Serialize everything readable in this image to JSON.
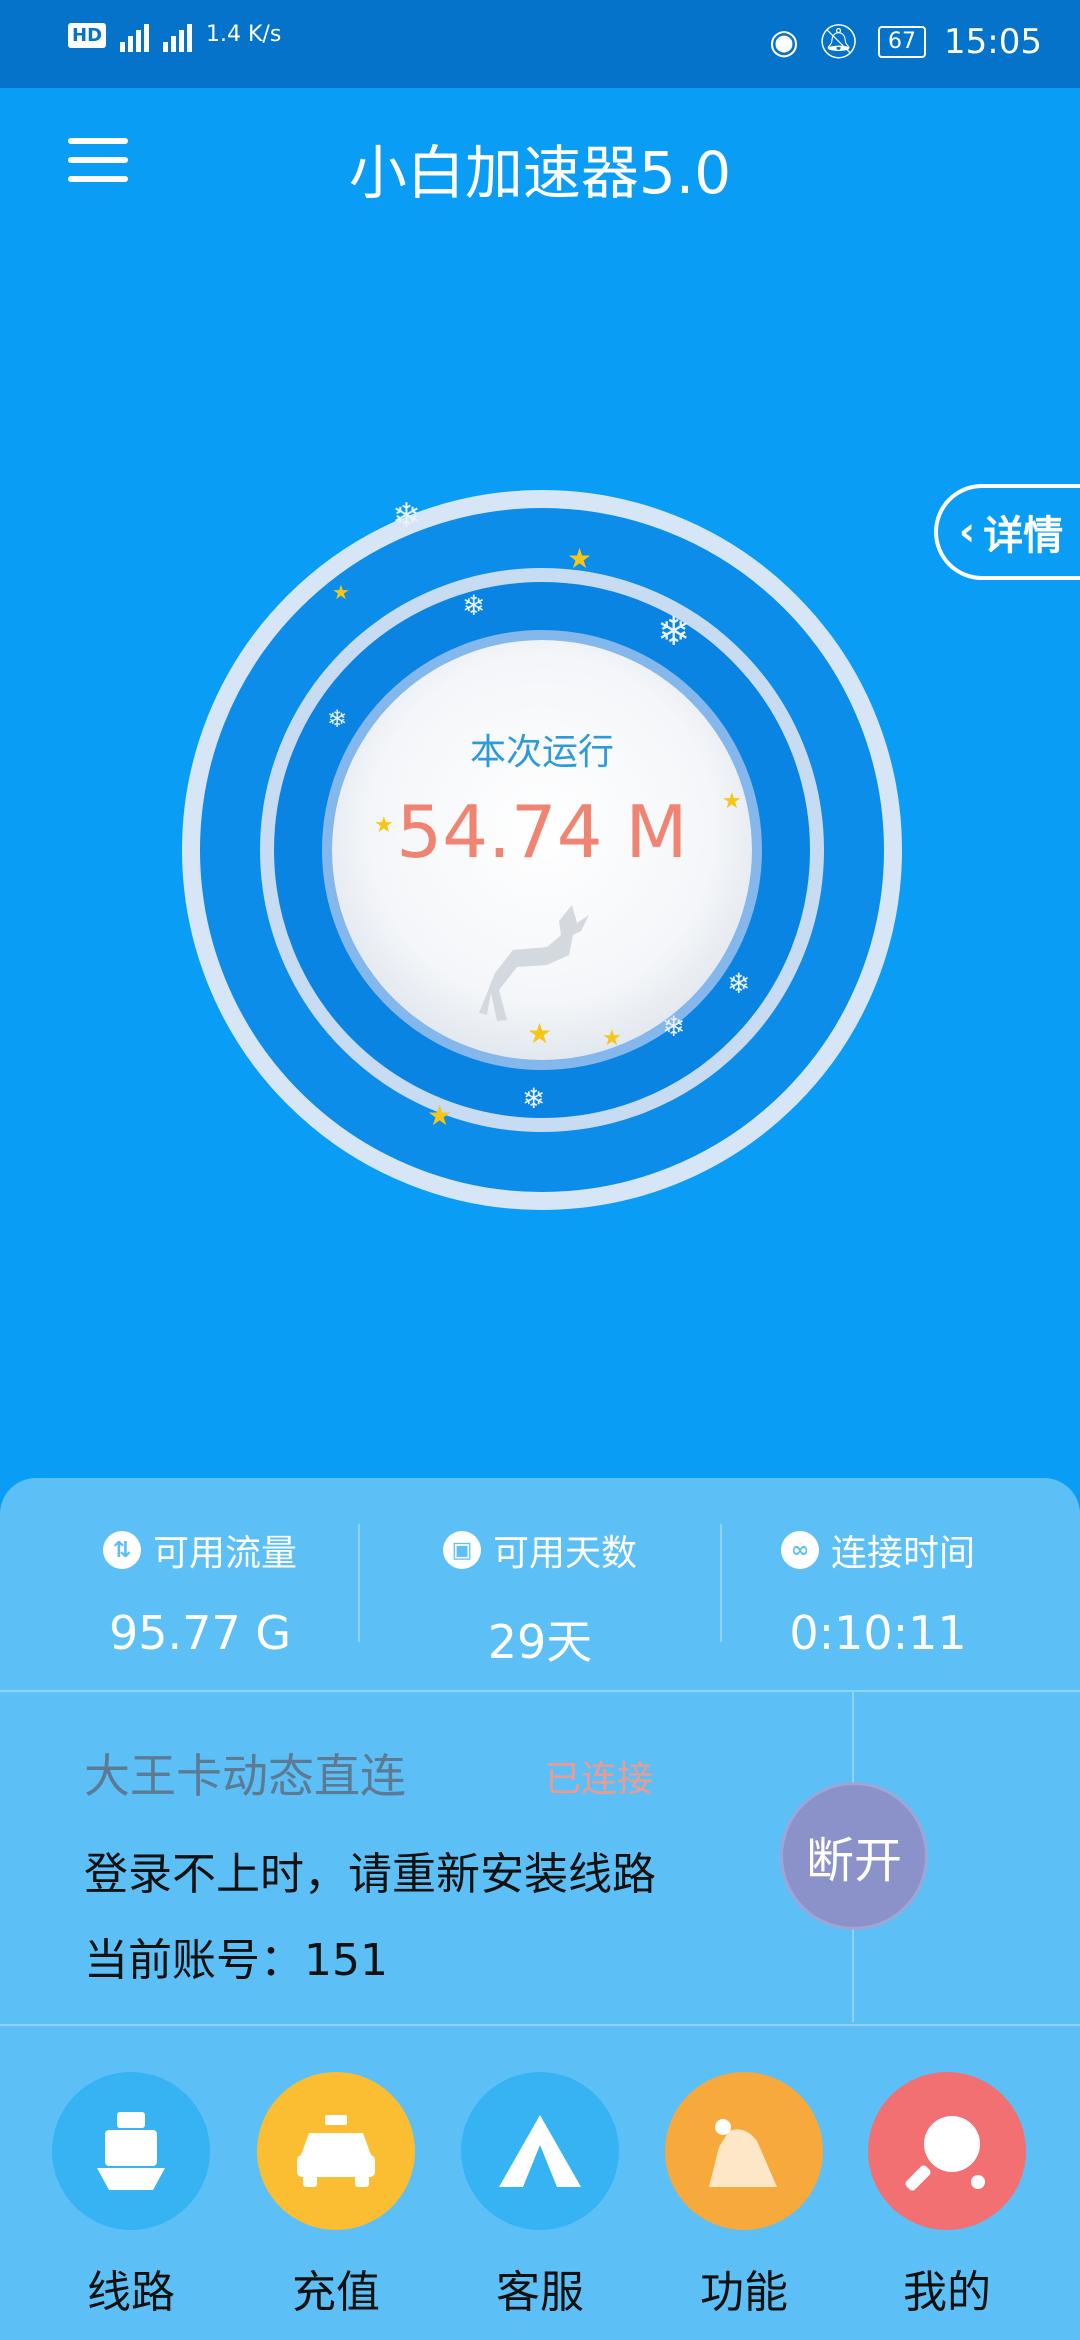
{
  "status_bar": {
    "hd_label": "HD",
    "net_rate": "1.4 K/s",
    "battery": "67",
    "time": "15:05"
  },
  "app": {
    "title": "小白加速器5.0"
  },
  "details_tab": {
    "label": "详情"
  },
  "gauge": {
    "label": "本次运行",
    "value": "54.74 M"
  },
  "stats": [
    {
      "icon": "data-transfer-icon",
      "label": "可用流量",
      "value": "95.77 G"
    },
    {
      "icon": "calendar-icon",
      "label": "可用天数",
      "value": "29天"
    },
    {
      "icon": "link-icon",
      "label": "连接时间",
      "value": "0:10:11"
    }
  ],
  "route": {
    "name": "大王卡动态直连",
    "state": "已连接",
    "tip": "登录不上时，请重新安装线路",
    "account": "当前账号：151"
  },
  "disconnect_label": "断开",
  "nav": [
    {
      "label": "线路",
      "icon": "ship-icon",
      "color": "#35b3f3"
    },
    {
      "label": "充值",
      "icon": "taxi-icon",
      "color": "#fbbd32"
    },
    {
      "label": "客服",
      "icon": "tent-icon",
      "color": "#35b3f3"
    },
    {
      "label": "功能",
      "icon": "mountain-icon",
      "color": "#f7a93b"
    },
    {
      "label": "我的",
      "icon": "ping-pong-icon",
      "color": "#f26f72"
    }
  ],
  "colors": {
    "background": "#0a9df5",
    "status_bar": "#0473c9",
    "panel": "#5cc0f7",
    "value_text": "#ef8473"
  }
}
